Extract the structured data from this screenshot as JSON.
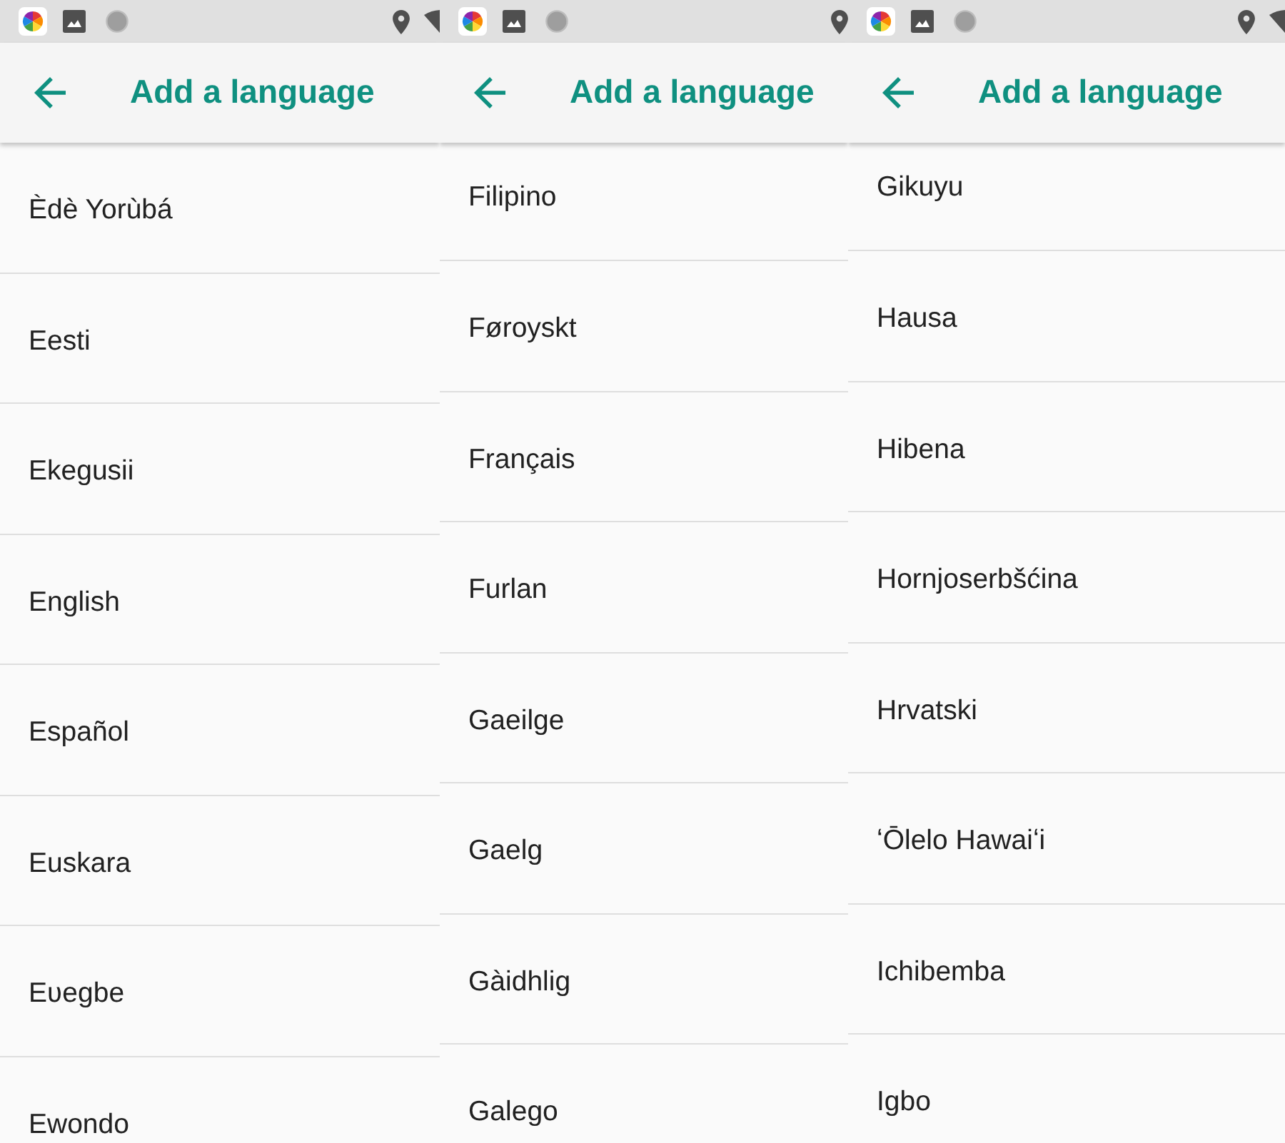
{
  "panels": [
    {
      "toolbar": {
        "title": "Add a language"
      },
      "languages": [
        "Èdè Yorùbá",
        "Eesti",
        "Ekegusii",
        "English",
        "Español",
        "Euskara",
        "Eʋegbe",
        "Ewondo"
      ]
    },
    {
      "toolbar": {
        "title": "Add a language"
      },
      "languages": [
        "Filipino",
        "Føroyskt",
        "Français",
        "Furlan",
        "Gaeilge",
        "Gaelg",
        "Gàidhlig",
        "Galego"
      ]
    },
    {
      "toolbar": {
        "title": "Add a language"
      },
      "languages": [
        "Gikuyu",
        "Hausa",
        "Hibena",
        "Hornjoserbšćina",
        "Hrvatski",
        "ʻŌlelo Hawaiʻi",
        "Ichibemba",
        "Igbo"
      ]
    }
  ]
}
